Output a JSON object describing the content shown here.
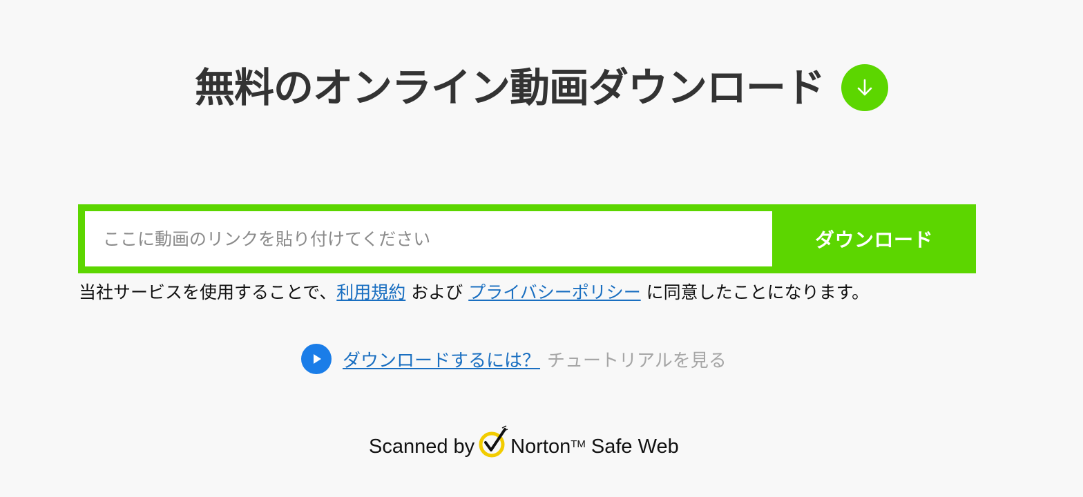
{
  "header": {
    "title": "無料のオンライン動画ダウンロード",
    "icon": "download-arrow-icon",
    "accent_color": "#5cd600"
  },
  "form": {
    "url_placeholder": "ここに動画のリンクを貼り付けてください",
    "url_value": "",
    "download_label": "ダウンロード",
    "button_color": "#5cd600"
  },
  "terms": {
    "prefix": "当社サービスを使用することで、",
    "terms_link": "利用規約",
    "connector": " および ",
    "privacy_link": "プライバシーポリシー",
    "suffix": " に同意したことになります。"
  },
  "tutorial": {
    "icon": "play-icon",
    "link_label": "ダウンロードするには？",
    "hint": "チュートリアルを見る"
  },
  "norton": {
    "prefix": "Scanned by",
    "brand": "Norton",
    "tm": "TM",
    "suffix": "Safe Web"
  }
}
